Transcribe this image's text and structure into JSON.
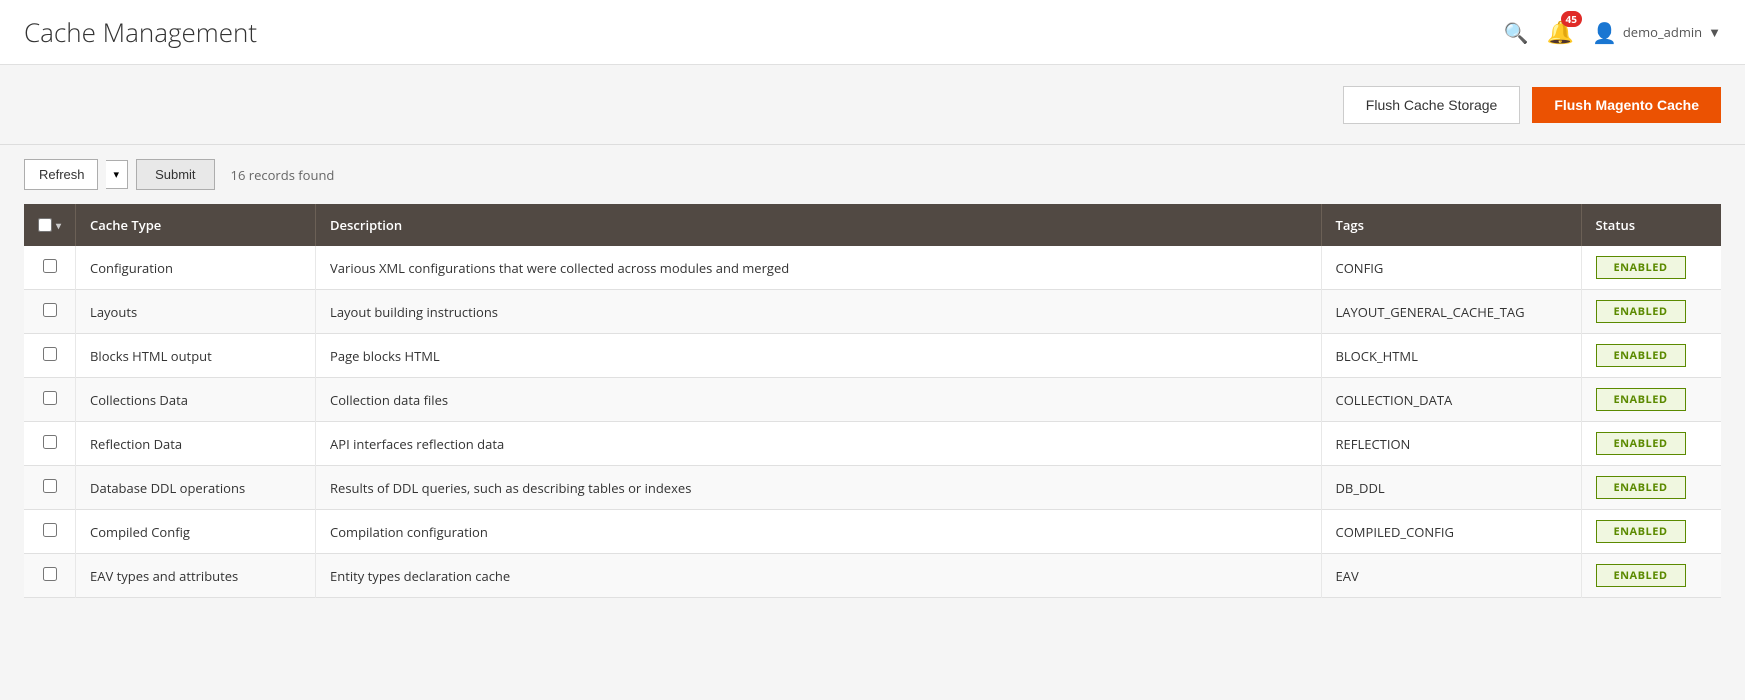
{
  "header": {
    "title": "Cache Management",
    "search_icon": "🔍",
    "notification_icon": "🔔",
    "notification_count": "45",
    "user_icon": "👤",
    "user_name": "demo_admin",
    "user_arrow": "▼"
  },
  "action_bar": {
    "flush_storage_label": "Flush Cache Storage",
    "flush_magento_label": "Flush Magento Cache"
  },
  "toolbar": {
    "refresh_label": "Refresh",
    "submit_label": "Submit",
    "records_found": "16 records found"
  },
  "table": {
    "columns": [
      "Cache Type",
      "Description",
      "Tags",
      "Status"
    ],
    "rows": [
      {
        "type": "Configuration",
        "description": "Various XML configurations that were collected across modules and merged",
        "tags": "CONFIG",
        "status": "ENABLED"
      },
      {
        "type": "Layouts",
        "description": "Layout building instructions",
        "tags": "LAYOUT_GENERAL_CACHE_TAG",
        "status": "ENABLED"
      },
      {
        "type": "Blocks HTML output",
        "description": "Page blocks HTML",
        "tags": "BLOCK_HTML",
        "status": "ENABLED"
      },
      {
        "type": "Collections Data",
        "description": "Collection data files",
        "tags": "COLLECTION_DATA",
        "status": "ENABLED"
      },
      {
        "type": "Reflection Data",
        "description": "API interfaces reflection data",
        "tags": "REFLECTION",
        "status": "ENABLED"
      },
      {
        "type": "Database DDL operations",
        "description": "Results of DDL queries, such as describing tables or indexes",
        "tags": "DB_DDL",
        "status": "ENABLED"
      },
      {
        "type": "Compiled Config",
        "description": "Compilation configuration",
        "tags": "COMPILED_CONFIG",
        "status": "ENABLED"
      },
      {
        "type": "EAV types and attributes",
        "description": "Entity types declaration cache",
        "tags": "EAV",
        "status": "ENABLED"
      }
    ]
  }
}
